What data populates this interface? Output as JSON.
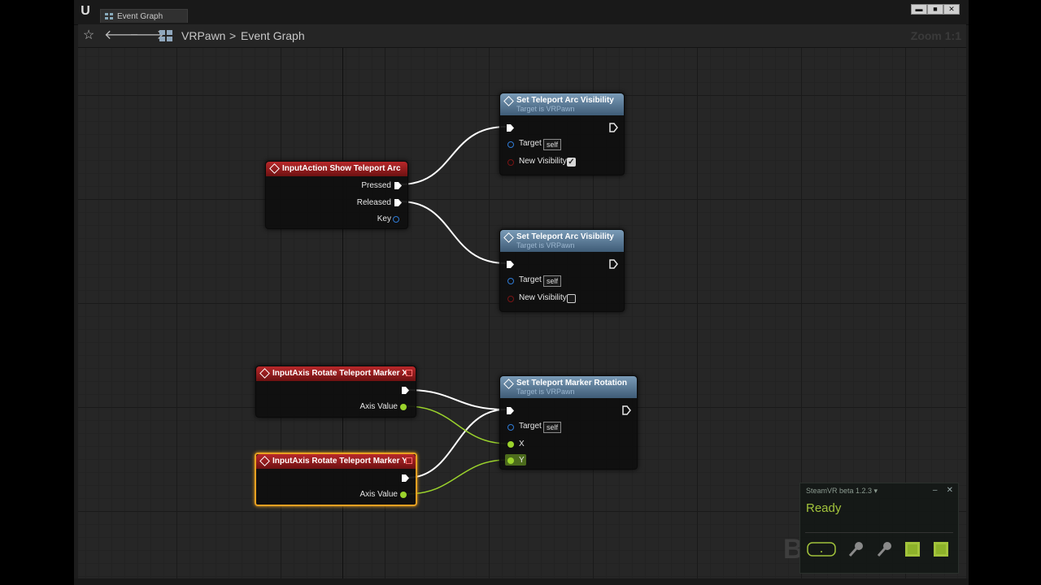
{
  "window": {
    "tab_label": "Event Graph",
    "controls": {
      "minimize": "▬",
      "maximize": "■",
      "close": "✕"
    }
  },
  "toolbar": {
    "breadcrumb_root": "VRPawn",
    "breadcrumb_separator": ">",
    "breadcrumb_current": "Event Graph",
    "zoom": "Zoom 1:1"
  },
  "nodes": {
    "input_action": {
      "title": "InputAction Show Teleport Arc",
      "pins": {
        "pressed": "Pressed",
        "released": "Released",
        "key": "Key"
      }
    },
    "set_vis_1": {
      "title": "Set Teleport Arc Visibility",
      "subtitle": "Target is VRPawn",
      "target_label": "Target",
      "target_value": "self",
      "visibility_label": "New Visibility",
      "visibility_checked": true
    },
    "set_vis_2": {
      "title": "Set Teleport Arc Visibility",
      "subtitle": "Target is VRPawn",
      "target_label": "Target",
      "target_value": "self",
      "visibility_label": "New Visibility",
      "visibility_checked": false
    },
    "axis_x": {
      "title": "InputAxis Rotate Teleport Marker X",
      "axis_label": "Axis Value"
    },
    "axis_y": {
      "title": "InputAxis Rotate Teleport Marker Y",
      "axis_label": "Axis Value",
      "selected": true
    },
    "set_rotation": {
      "title": "Set Teleport Marker Rotation",
      "subtitle": "Target is VRPawn",
      "target_label": "Target",
      "target_value": "self",
      "x_label": "X",
      "y_label": "Y"
    }
  },
  "steamvr": {
    "title": "SteamVR beta 1.2.3 ▾",
    "minimize": "–",
    "close": "✕",
    "status": "Ready",
    "status_color": "#a2c33b"
  },
  "colors": {
    "event_header": "#b8282a",
    "function_header": "#5f7f9c",
    "exec_wire": "#ffffff",
    "float_wire": "#9bd32c",
    "selection": "#e8a021"
  }
}
